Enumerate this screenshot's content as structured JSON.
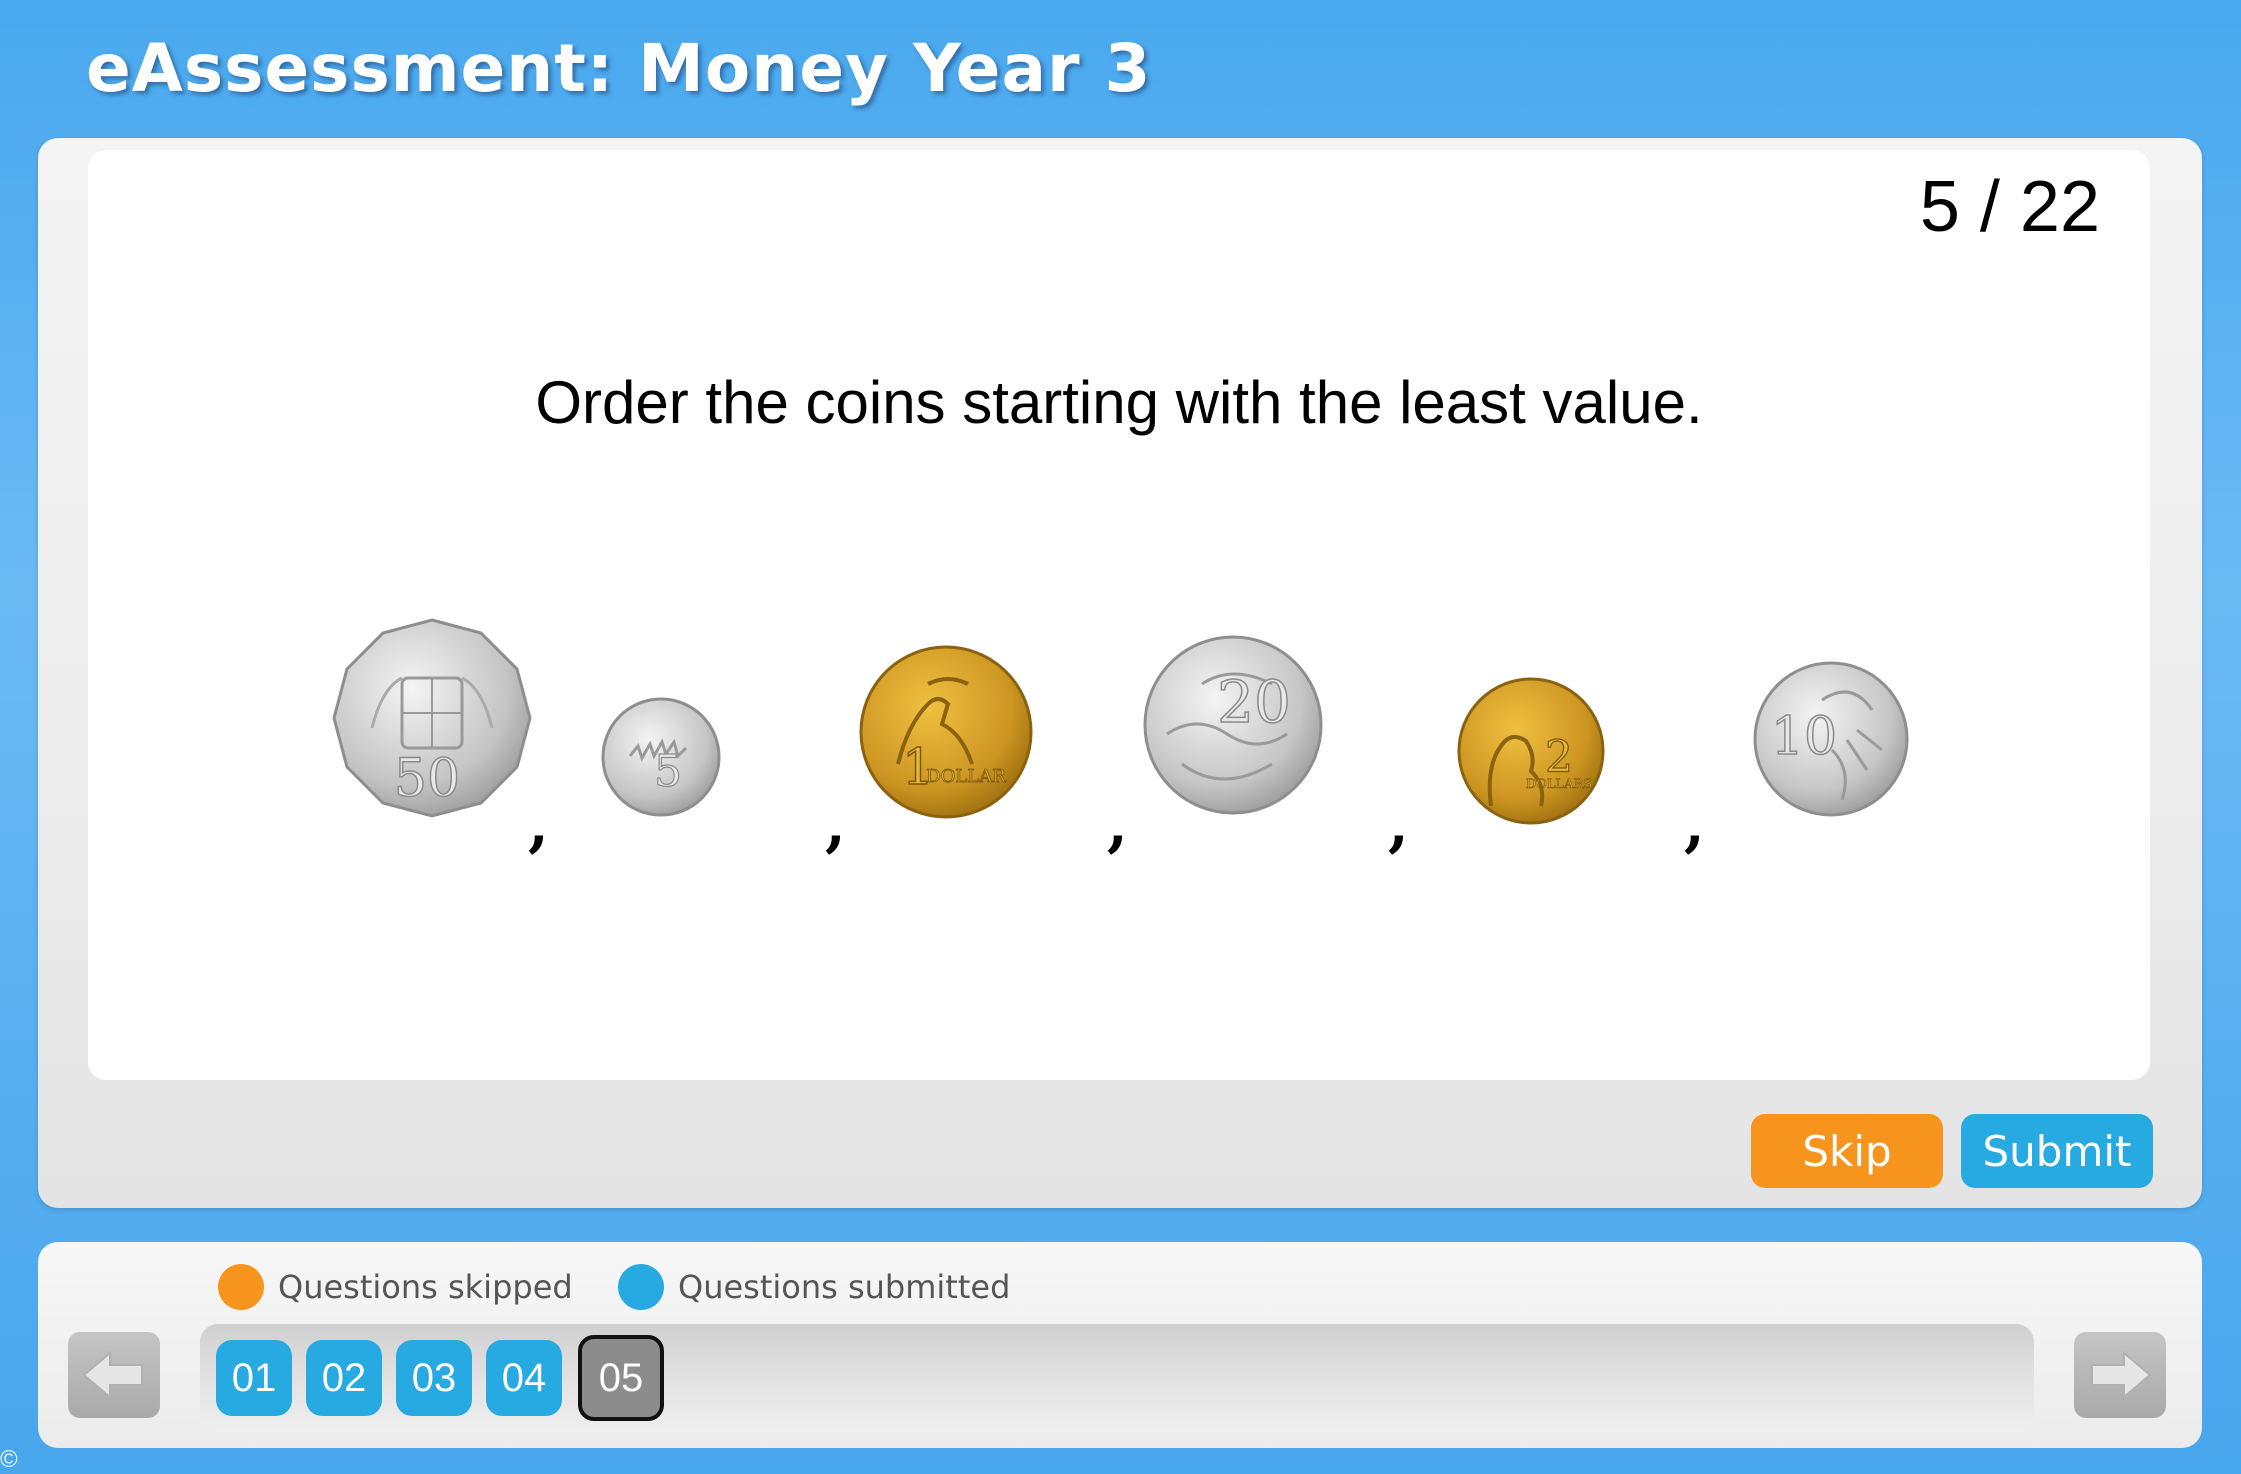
{
  "header": {
    "title": "eAssessment: Money Year 3"
  },
  "question": {
    "counter": "5 / 22",
    "prompt": "Order the coins starting with the least value.",
    "coins": [
      {
        "name": "50-cent-coin",
        "label": "50"
      },
      {
        "name": "5-cent-coin",
        "label": "5"
      },
      {
        "name": "1-dollar-coin",
        "label": "1",
        "sublabel": "DOLLAR"
      },
      {
        "name": "20-cent-coin",
        "label": "20"
      },
      {
        "name": "2-dollar-coin",
        "label": "2",
        "sublabel": "DOLLARS"
      },
      {
        "name": "10-cent-coin",
        "label": "10"
      }
    ],
    "separator": ","
  },
  "actions": {
    "skip": "Skip",
    "submit": "Submit"
  },
  "legend": {
    "skipped": "Questions skipped",
    "submitted": "Questions submitted"
  },
  "navigation": {
    "questions": [
      "01",
      "02",
      "03",
      "04",
      "05"
    ],
    "current": "05"
  },
  "footer": {
    "copyright": "©"
  },
  "colors": {
    "skip": "#f7941d",
    "submit": "#27aae1",
    "silver": "#c9c9c9",
    "gold": "#c9951c"
  }
}
